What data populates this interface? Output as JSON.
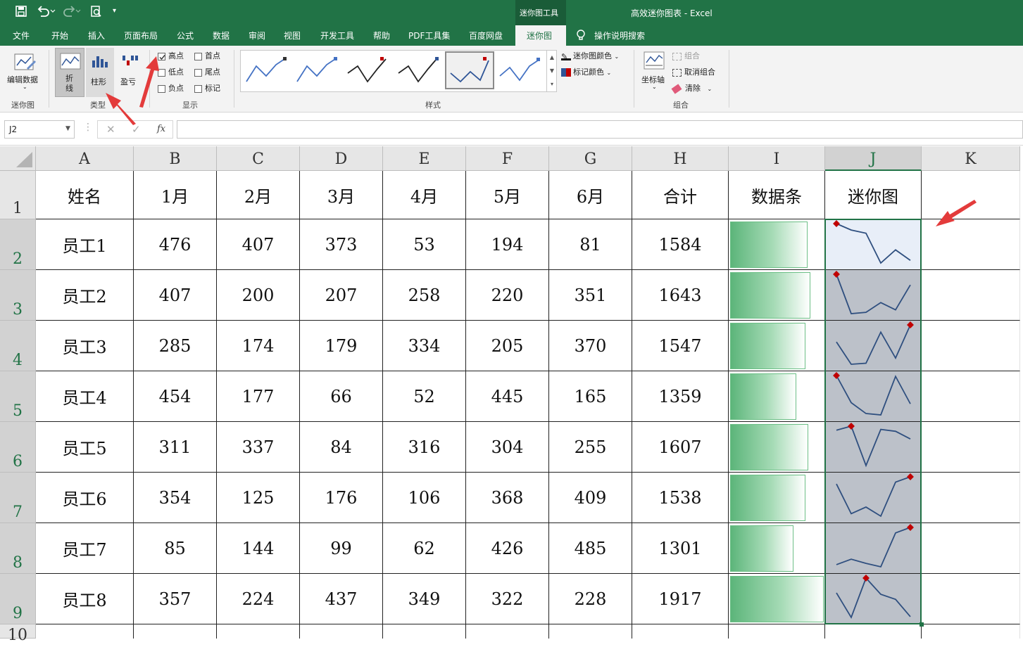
{
  "window": {
    "context_tab": "迷你图工具",
    "title": "高效迷你图表 - Excel"
  },
  "tabs": [
    "文件",
    "开始",
    "插入",
    "页面布局",
    "公式",
    "数据",
    "审阅",
    "视图",
    "开发工具",
    "帮助",
    "PDF工具集",
    "百度网盘",
    "迷你图"
  ],
  "active_tab": "迷你图",
  "search_label": "操作说明搜索",
  "ribbon": {
    "edit_data": "编辑数据",
    "group_sparkline": "迷你图",
    "type_line": "折线",
    "type_column": "柱形",
    "type_winloss": "盈亏",
    "group_type": "类型",
    "show": [
      {
        "label": "高点",
        "checked": true
      },
      {
        "label": "首点",
        "checked": false
      },
      {
        "label": "低点",
        "checked": false
      },
      {
        "label": "尾点",
        "checked": false
      },
      {
        "label": "负点",
        "checked": false
      },
      {
        "label": "标记",
        "checked": false
      }
    ],
    "group_show": "显示",
    "group_style": "样式",
    "sparkline_color": "迷你图颜色",
    "marker_color": "标记颜色",
    "axis": "坐标轴",
    "group_btn": "组合",
    "ungroup": "取消组合",
    "clear": "清除",
    "group_group": "组合"
  },
  "formula_bar": {
    "name_box": "J2",
    "fx": "fx",
    "formula": ""
  },
  "sheet": {
    "columns": [
      "A",
      "B",
      "C",
      "D",
      "E",
      "F",
      "G",
      "H",
      "I",
      "J",
      "K"
    ],
    "row_numbers": [
      "1",
      "2",
      "3",
      "4",
      "5",
      "6",
      "7",
      "8",
      "9",
      "10"
    ],
    "headers": [
      "姓名",
      "1月",
      "2月",
      "3月",
      "4月",
      "5月",
      "6月",
      "合计",
      "数据条",
      "迷你图"
    ],
    "rows": [
      {
        "name": "员工1",
        "values": [
          476,
          407,
          373,
          53,
          194,
          81
        ],
        "total": 1584
      },
      {
        "name": "员工2",
        "values": [
          407,
          200,
          207,
          258,
          220,
          351
        ],
        "total": 1643
      },
      {
        "name": "员工3",
        "values": [
          285,
          174,
          179,
          334,
          205,
          370
        ],
        "total": 1547
      },
      {
        "name": "员工4",
        "values": [
          454,
          177,
          66,
          52,
          445,
          165
        ],
        "total": 1359
      },
      {
        "name": "员工5",
        "values": [
          311,
          337,
          84,
          316,
          304,
          255
        ],
        "total": 1607
      },
      {
        "name": "员工6",
        "values": [
          354,
          125,
          176,
          106,
          368,
          409
        ],
        "total": 1538
      },
      {
        "name": "员工7",
        "values": [
          85,
          144,
          99,
          62,
          426,
          485
        ],
        "total": 1301
      },
      {
        "name": "员工8",
        "values": [
          357,
          224,
          437,
          349,
          322,
          228
        ],
        "total": 1917
      }
    ],
    "databar_max": 1917
  },
  "colors": {
    "excel_green": "#217346",
    "sparkline": "#2f4f7f",
    "high_marker": "#c00000",
    "selection": "#bcc1c9",
    "arrow": "#e33b3b"
  }
}
